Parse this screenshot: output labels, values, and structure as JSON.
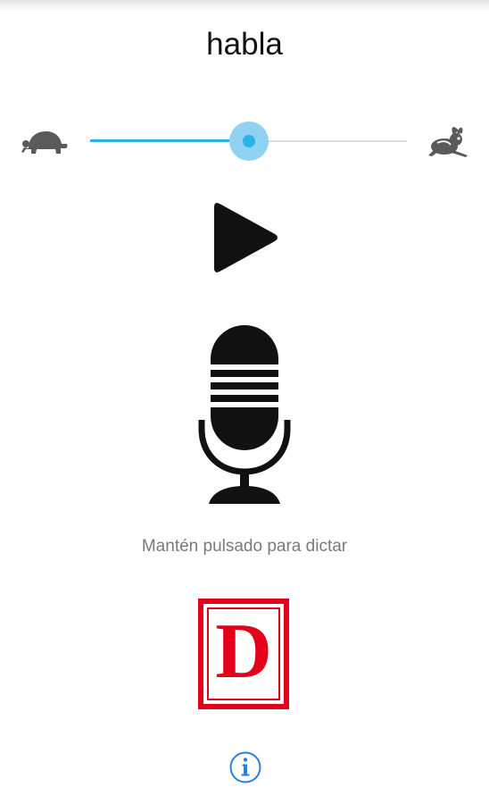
{
  "app": {
    "title": "habla"
  },
  "speed_slider": {
    "value_fraction": 0.5,
    "min_icon": "tortoise-icon",
    "max_icon": "hare-icon",
    "colors": {
      "fill": "#29b3e6",
      "halo": "#8fd2f1",
      "track": "#dddddd"
    }
  },
  "controls": {
    "play_icon": "play-icon",
    "mic_icon": "microphone-icon",
    "hint": "Mantén pulsado para dictar"
  },
  "logo": {
    "letter": "D",
    "color": "#e4001b"
  },
  "info": {
    "icon": "info-icon",
    "color": "#2a7de1"
  }
}
